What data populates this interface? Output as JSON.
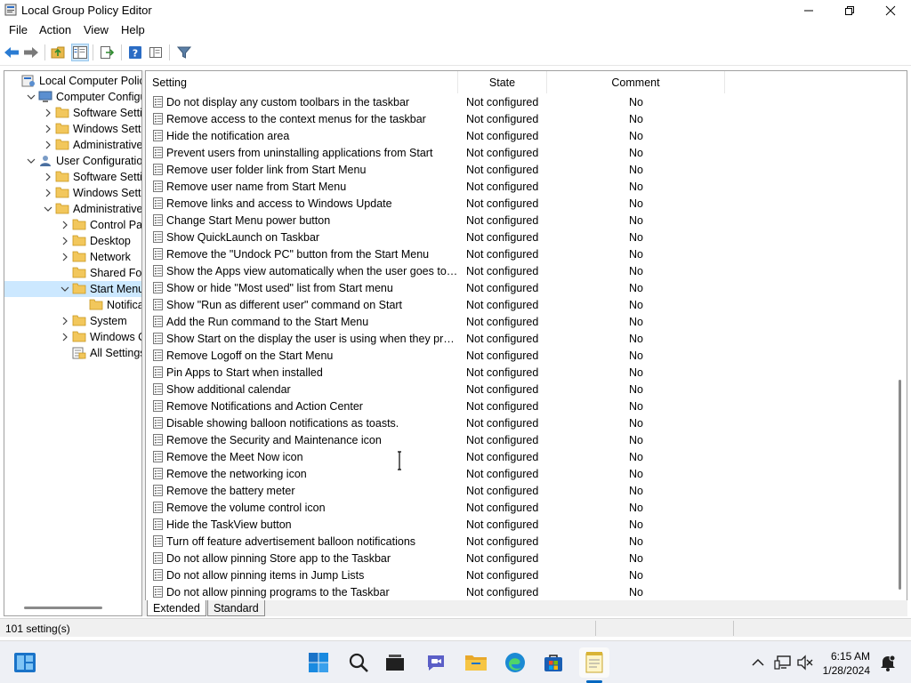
{
  "window": {
    "title": "Local Group Policy Editor",
    "accent": "#0067c0"
  },
  "menu": [
    "File",
    "Action",
    "View",
    "Help"
  ],
  "toolbar": {
    "icons": [
      "back-arrow-icon",
      "forward-arrow-icon",
      "up-folder-icon",
      "show-hide-tree-icon",
      "export-list-icon",
      "help-icon",
      "properties-icon",
      "filter-icon"
    ]
  },
  "tree": [
    {
      "label": "Local Computer Policy",
      "icon": "policy-computer-icon",
      "chevron": "none"
    },
    {
      "label": "Computer Configuration",
      "icon": "computer-icon",
      "chevron": "down"
    },
    {
      "label": "Software Settings",
      "icon": "folder-icon",
      "chevron": "right"
    },
    {
      "label": "Windows Settings",
      "icon": "folder-icon",
      "chevron": "right"
    },
    {
      "label": "Administrative Templates",
      "icon": "folder-icon",
      "chevron": "right"
    },
    {
      "label": "User Configuration",
      "icon": "user-icon",
      "chevron": "down"
    },
    {
      "label": "Software Settings",
      "icon": "folder-icon",
      "chevron": "right"
    },
    {
      "label": "Windows Settings",
      "icon": "folder-icon",
      "chevron": "right"
    },
    {
      "label": "Administrative Templates",
      "icon": "folder-icon",
      "chevron": "down"
    },
    {
      "label": "Control Panel",
      "icon": "folder-icon",
      "chevron": "right"
    },
    {
      "label": "Desktop",
      "icon": "folder-icon",
      "chevron": "right"
    },
    {
      "label": "Network",
      "icon": "folder-icon",
      "chevron": "right"
    },
    {
      "label": "Shared Folders",
      "icon": "folder-icon",
      "chevron": "none"
    },
    {
      "label": "Start Menu and Taskbar",
      "icon": "folder-open-icon",
      "chevron": "down",
      "selected": true
    },
    {
      "label": "Notifications",
      "icon": "folder-icon",
      "chevron": "none"
    },
    {
      "label": "System",
      "icon": "folder-icon",
      "chevron": "right"
    },
    {
      "label": "Windows Components",
      "icon": "folder-icon",
      "chevron": "right"
    },
    {
      "label": "All Settings",
      "icon": "all-settings-icon",
      "chevron": "none"
    }
  ],
  "columns": {
    "setting": "Setting",
    "state": "State",
    "comment": "Comment"
  },
  "rows": [
    {
      "setting": "Do not display any custom toolbars in the taskbar",
      "state": "Not configured",
      "comment": "No"
    },
    {
      "setting": "Remove access to the context menus for the taskbar",
      "state": "Not configured",
      "comment": "No"
    },
    {
      "setting": "Hide the notification area",
      "state": "Not configured",
      "comment": "No"
    },
    {
      "setting": "Prevent users from uninstalling applications from Start",
      "state": "Not configured",
      "comment": "No"
    },
    {
      "setting": "Remove user folder link from Start Menu",
      "state": "Not configured",
      "comment": "No"
    },
    {
      "setting": "Remove user name from Start Menu",
      "state": "Not configured",
      "comment": "No"
    },
    {
      "setting": "Remove links and access to Windows Update",
      "state": "Not configured",
      "comment": "No"
    },
    {
      "setting": "Change Start Menu power button",
      "state": "Not configured",
      "comment": "No"
    },
    {
      "setting": "Show QuickLaunch on Taskbar",
      "state": "Not configured",
      "comment": "No"
    },
    {
      "setting": "Remove the \"Undock PC\" button from the Start Menu",
      "state": "Not configured",
      "comment": "No"
    },
    {
      "setting": "Show the Apps view automatically when the user goes to Start",
      "state": "Not configured",
      "comment": "No"
    },
    {
      "setting": "Show or hide \"Most used\" list from Start menu",
      "state": "Not configured",
      "comment": "No"
    },
    {
      "setting": "Show \"Run as different user\" command on Start",
      "state": "Not configured",
      "comment": "No"
    },
    {
      "setting": "Add the Run command to the Start Menu",
      "state": "Not configured",
      "comment": "No"
    },
    {
      "setting": "Show Start on the display the user is using when they press the Windows logo key",
      "state": "Not configured",
      "comment": "No"
    },
    {
      "setting": "Remove Logoff on the Start Menu",
      "state": "Not configured",
      "comment": "No"
    },
    {
      "setting": "Pin Apps to Start when installed",
      "state": "Not configured",
      "comment": "No"
    },
    {
      "setting": "Show additional calendar",
      "state": "Not configured",
      "comment": "No"
    },
    {
      "setting": "Remove Notifications and Action Center",
      "state": "Not configured",
      "comment": "No"
    },
    {
      "setting": "Disable showing balloon notifications as toasts.",
      "state": "Not configured",
      "comment": "No"
    },
    {
      "setting": "Remove the Security and Maintenance icon",
      "state": "Not configured",
      "comment": "No"
    },
    {
      "setting": "Remove the Meet Now icon",
      "state": "Not configured",
      "comment": "No"
    },
    {
      "setting": "Remove the networking icon",
      "state": "Not configured",
      "comment": "No"
    },
    {
      "setting": "Remove the battery meter",
      "state": "Not configured",
      "comment": "No"
    },
    {
      "setting": "Remove the volume control icon",
      "state": "Not configured",
      "comment": "No"
    },
    {
      "setting": "Hide the TaskView button",
      "state": "Not configured",
      "comment": "No"
    },
    {
      "setting": "Turn off feature advertisement balloon notifications",
      "state": "Not configured",
      "comment": "No"
    },
    {
      "setting": "Do not allow pinning Store app to the Taskbar",
      "state": "Not configured",
      "comment": "No"
    },
    {
      "setting": "Do not allow pinning items in Jump Lists",
      "state": "Not configured",
      "comment": "No"
    },
    {
      "setting": "Do not allow pinning programs to the Taskbar",
      "state": "Not configured",
      "comment": "No"
    }
  ],
  "tabs": [
    "Extended",
    "Standard"
  ],
  "status": {
    "count": "101 setting(s)"
  },
  "taskbar": {
    "apps": [
      "widgets-icon",
      "start-icon",
      "search-icon",
      "task-view-icon",
      "chat-icon",
      "file-explorer-icon",
      "edge-icon",
      "store-icon",
      "notepad-icon"
    ],
    "time": "6:15 AM",
    "date": "1/28/2024"
  }
}
